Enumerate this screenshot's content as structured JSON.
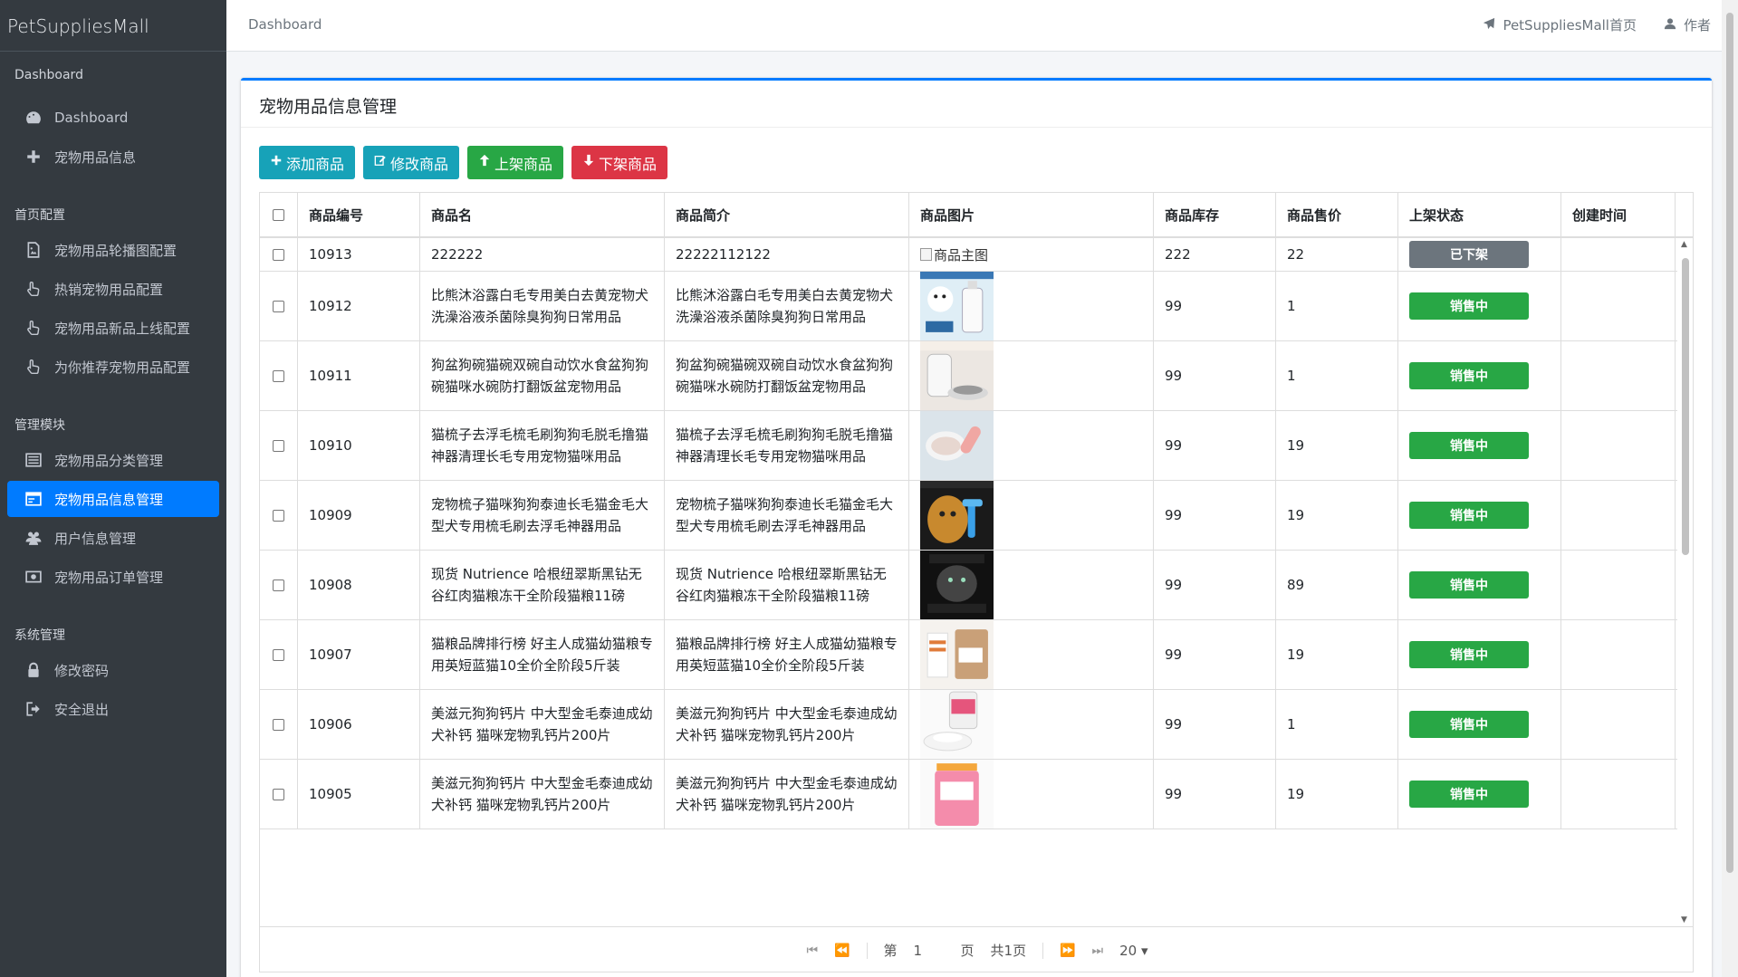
{
  "brand": "PetSuppliesMall",
  "sidebar": {
    "sections": [
      {
        "header": "Dashboard",
        "items": [
          {
            "label": "Dashboard",
            "icon": "dashboard-icon"
          },
          {
            "label": "宠物用品信息",
            "icon": "plus-icon"
          }
        ]
      },
      {
        "header": "首页配置",
        "items": [
          {
            "label": "宠物用品轮播图配置",
            "icon": "image-icon"
          },
          {
            "label": "热销宠物用品配置",
            "icon": "hand-pointer-icon"
          },
          {
            "label": "宠物用品新品上线配置",
            "icon": "hand-pointer-icon"
          },
          {
            "label": "为你推荐宠物用品配置",
            "icon": "hand-pointer-icon"
          }
        ]
      },
      {
        "header": "管理模块",
        "items": [
          {
            "label": "宠物用品分类管理",
            "icon": "list-icon"
          },
          {
            "label": "宠物用品信息管理",
            "icon": "card-icon",
            "active": true
          },
          {
            "label": "用户信息管理",
            "icon": "users-icon"
          },
          {
            "label": "宠物用品订单管理",
            "icon": "money-icon"
          }
        ]
      },
      {
        "header": "系统管理",
        "items": [
          {
            "label": "修改密码",
            "icon": "lock-icon"
          },
          {
            "label": "安全退出",
            "icon": "sign-out-icon"
          }
        ]
      }
    ]
  },
  "topbar": {
    "breadcrumb": "Dashboard",
    "home_link": "PetSuppliesMall首页",
    "author_link": "作者"
  },
  "card": {
    "title": "宠物用品信息管理",
    "buttons": {
      "add": "添加商品",
      "edit": "修改商品",
      "up": "上架商品",
      "down": "下架商品"
    }
  },
  "table": {
    "headers": [
      "商品编号",
      "商品名",
      "商品简介",
      "商品图片",
      "商品库存",
      "商品售价",
      "上架状态",
      "创建时间"
    ],
    "rows": [
      {
        "id": "10913",
        "name": "222222",
        "intro": "22222112122",
        "img": "broken",
        "img_alt": "商品主图",
        "stock": "222",
        "price": "22",
        "status": "已下架",
        "created": ""
      },
      {
        "id": "10912",
        "name": "比熊沐浴露白毛专用美白去黄宠物犬洗澡浴液杀菌除臭狗狗日常用品",
        "intro": "比熊沐浴露白毛专用美白去黄宠物犬洗澡浴液杀菌除臭狗狗日常用品",
        "img": "shampoo",
        "stock": "99",
        "price": "1",
        "status": "销售中",
        "created": ""
      },
      {
        "id": "10911",
        "name": "狗盆狗碗猫碗双碗自动饮水食盆狗狗碗猫咪水碗防打翻饭盆宠物用品",
        "intro": "狗盆狗碗猫碗双碗自动饮水食盆狗狗碗猫咪水碗防打翻饭盆宠物用品",
        "img": "bowl",
        "stock": "99",
        "price": "1",
        "status": "销售中",
        "created": ""
      },
      {
        "id": "10910",
        "name": "猫梳子去浮毛梳毛刷狗狗毛脱毛撸猫神器清理长毛专用宠物猫咪用品",
        "intro": "猫梳子去浮毛梳毛刷狗狗毛脱毛撸猫神器清理长毛专用宠物猫咪用品",
        "img": "brush",
        "stock": "99",
        "price": "19",
        "status": "销售中",
        "created": ""
      },
      {
        "id": "10909",
        "name": "宠物梳子猫咪狗狗泰迪长毛猫金毛大型犬专用梳毛刷去浮毛神器用品",
        "intro": "宠物梳子猫咪狗狗泰迪长毛猫金毛大型犬专用梳毛刷去浮毛神器用品",
        "img": "dog",
        "stock": "99",
        "price": "19",
        "status": "销售中",
        "created": ""
      },
      {
        "id": "10908",
        "name": "现货 Nutrience 哈根纽翠斯黑钻无谷红肉猫粮冻干全阶段猫粮11磅",
        "intro": "现货 Nutrience 哈根纽翠斯黑钻无谷红肉猫粮冻干全阶段猫粮11磅",
        "img": "catfood",
        "stock": "99",
        "price": "89",
        "status": "销售中",
        "created": ""
      },
      {
        "id": "10907",
        "name": "猫粮品牌排行榜 好主人成猫幼猫粮专用英短蓝猫10全价全阶段5斤装",
        "intro": "猫粮品牌排行榜 好主人成猫幼猫粮专用英短蓝猫10全价全阶段5斤装",
        "img": "bag",
        "stock": "99",
        "price": "19",
        "status": "销售中",
        "created": ""
      },
      {
        "id": "10906",
        "name": "美滋元狗狗钙片 中大型金毛泰迪成幼犬补钙 猫咪宠物乳钙片200片",
        "intro": "美滋元狗狗钙片 中大型金毛泰迪成幼犬补钙 猫咪宠物乳钙片200片",
        "img": "calcium",
        "stock": "99",
        "price": "1",
        "status": "销售中",
        "created": ""
      },
      {
        "id": "10905",
        "name": "美滋元狗狗钙片 中大型金毛泰迪成幼犬补钙 猫咪宠物乳钙片200片",
        "intro": "美滋元狗狗钙片 中大型金毛泰迪成幼犬补钙 猫咪宠物乳钙片200片",
        "img": "jar",
        "stock": "99",
        "price": "19",
        "status": "销售中",
        "created": ""
      }
    ]
  },
  "pager": {
    "page_prefix": "第",
    "page_value": "1",
    "page_suffix": "页",
    "total": "共1页",
    "page_size": "20"
  },
  "colors": {
    "sidebar_bg": "#343a40",
    "active": "#007bff",
    "info": "#17a2b8",
    "success": "#28a745",
    "danger": "#dc3545",
    "off_status": "#6c757d"
  }
}
